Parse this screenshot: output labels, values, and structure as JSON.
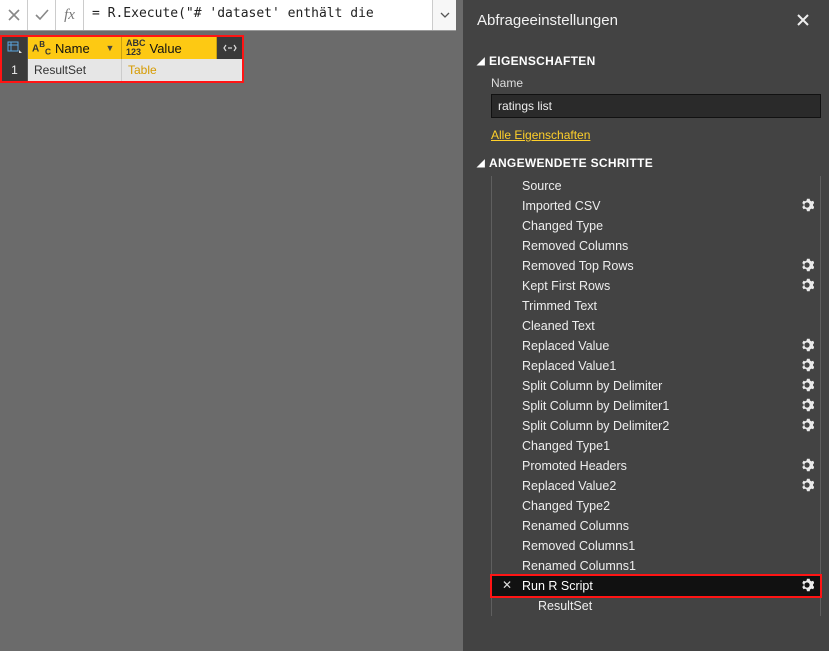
{
  "formula": {
    "text": "= R.Execute(\"# 'dataset' enthält die"
  },
  "table": {
    "columns": [
      {
        "label": "Name"
      },
      {
        "label": "Value"
      }
    ],
    "rows": [
      {
        "index": "1",
        "name": "ResultSet",
        "value": "Table"
      }
    ]
  },
  "panel": {
    "title": "Abfrageeinstellungen",
    "section_properties": "EIGENSCHAFTEN",
    "name_label": "Name",
    "name_value": "ratings list",
    "all_properties": "Alle Eigenschaften",
    "section_steps": "ANGEWENDETE SCHRITTE",
    "steps": [
      {
        "label": "Source",
        "gear": false,
        "selected": false
      },
      {
        "label": "Imported CSV",
        "gear": true,
        "selected": false
      },
      {
        "label": "Changed Type",
        "gear": false,
        "selected": false
      },
      {
        "label": "Removed Columns",
        "gear": false,
        "selected": false
      },
      {
        "label": "Removed Top Rows",
        "gear": true,
        "selected": false
      },
      {
        "label": "Kept First Rows",
        "gear": true,
        "selected": false
      },
      {
        "label": "Trimmed Text",
        "gear": false,
        "selected": false
      },
      {
        "label": "Cleaned Text",
        "gear": false,
        "selected": false
      },
      {
        "label": "Replaced Value",
        "gear": true,
        "selected": false
      },
      {
        "label": "Replaced Value1",
        "gear": true,
        "selected": false
      },
      {
        "label": "Split Column by Delimiter",
        "gear": true,
        "selected": false
      },
      {
        "label": "Split Column by Delimiter1",
        "gear": true,
        "selected": false
      },
      {
        "label": "Split Column by Delimiter2",
        "gear": true,
        "selected": false
      },
      {
        "label": "Changed Type1",
        "gear": false,
        "selected": false
      },
      {
        "label": "Promoted Headers",
        "gear": true,
        "selected": false
      },
      {
        "label": "Replaced Value2",
        "gear": true,
        "selected": false
      },
      {
        "label": "Changed Type2",
        "gear": false,
        "selected": false
      },
      {
        "label": "Renamed Columns",
        "gear": false,
        "selected": false
      },
      {
        "label": "Removed Columns1",
        "gear": false,
        "selected": false
      },
      {
        "label": "Renamed Columns1",
        "gear": false,
        "selected": false
      },
      {
        "label": "Run R Script",
        "gear": true,
        "selected": true
      },
      {
        "label": "ResultSet",
        "gear": false,
        "selected": false,
        "final": true
      }
    ]
  }
}
